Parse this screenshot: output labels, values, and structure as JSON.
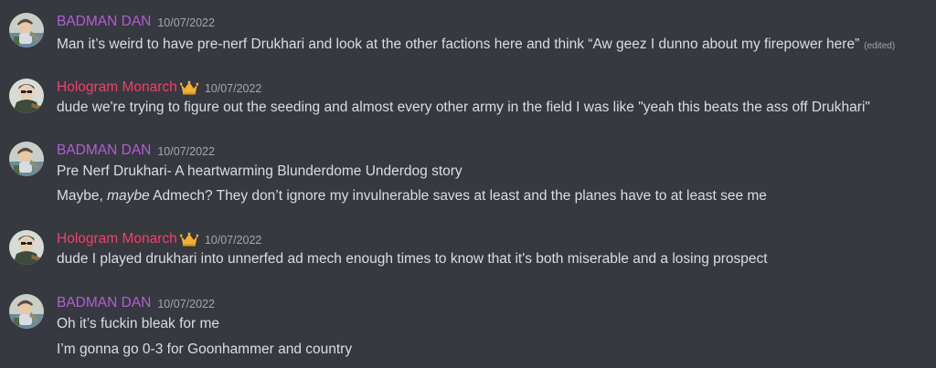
{
  "colors": {
    "background": "#36393f",
    "text": "#dcddde",
    "muted": "#a3a6aa",
    "badman_name": "#b45dd6",
    "hologram_name": "#f23f6e"
  },
  "messages": [
    {
      "author": "BADMAN DAN",
      "timestamp": "10/07/2022",
      "lines": [
        {
          "text": "Man it’s weird to have pre-nerf Drukhari and look at the other factions here and think “Aw geez I dunno about my firepower here”",
          "edited": "(edited)"
        }
      ]
    },
    {
      "author": "Hologram Monarch",
      "timestamp": "10/07/2022",
      "badge_icon": "crown-icon",
      "lines": [
        {
          "text": "dude we're trying to figure out the seeding and almost every other army in the field I was like \"yeah this beats the ass off Drukhari\""
        }
      ]
    },
    {
      "author": "BADMAN DAN",
      "timestamp": "10/07/2022",
      "lines": [
        {
          "text": "Pre Nerf Drukhari- A heartwarming Blunderdome Underdog story"
        },
        {
          "prefix": "Maybe, ",
          "italic": "maybe",
          "suffix": " Admech? They don’t ignore my invulnerable saves at least and the planes have to at least see me"
        }
      ]
    },
    {
      "author": "Hologram Monarch",
      "timestamp": "10/07/2022",
      "badge_icon": "crown-icon",
      "lines": [
        {
          "text": "dude I played drukhari into unnerfed ad mech enough times to know that it's both miserable and a losing prospect"
        }
      ]
    },
    {
      "author": "BADMAN DAN",
      "timestamp": "10/07/2022",
      "lines": [
        {
          "text": "Oh it’s fuckin bleak for me"
        },
        {
          "text": "I’m gonna go 0-3 for Goonhammer and country"
        }
      ]
    }
  ]
}
